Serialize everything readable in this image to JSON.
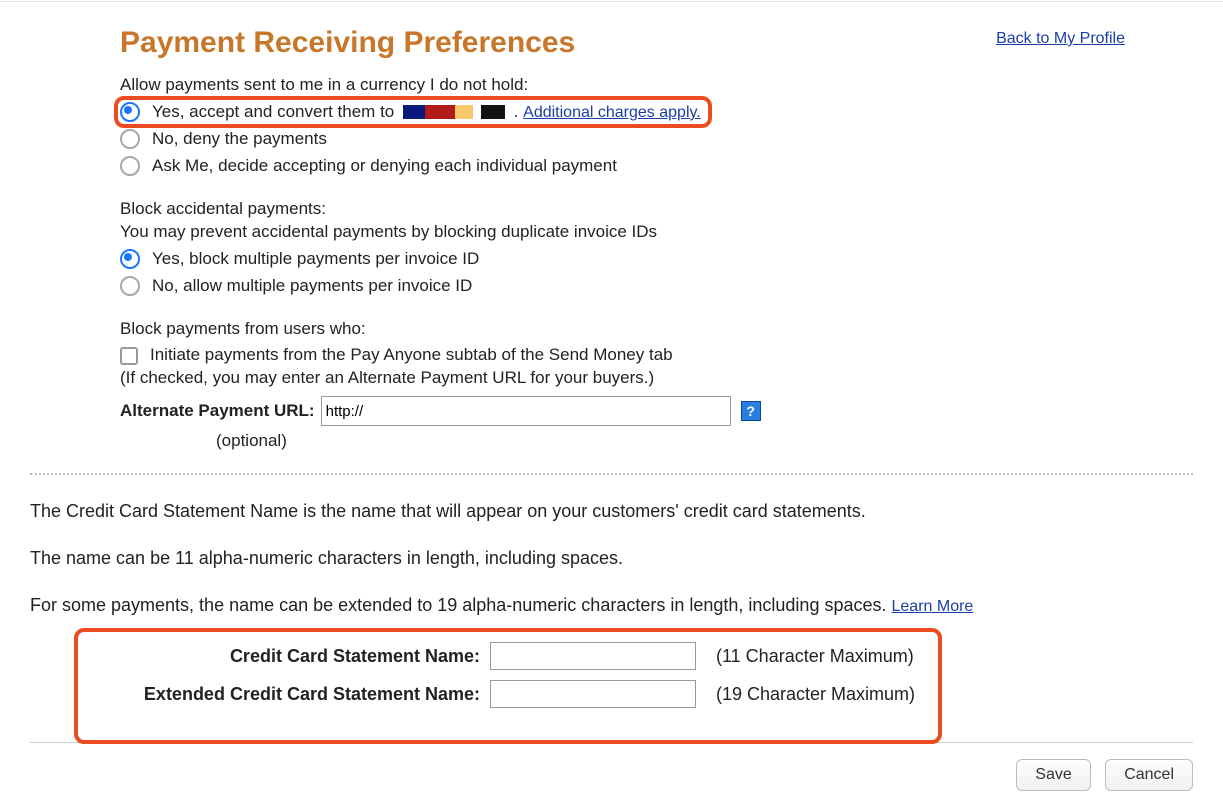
{
  "header": {
    "title": "Payment Receiving Preferences",
    "back_link": "Back to My Profile"
  },
  "currency_section": {
    "question": "Allow payments sent to me in a currency I do not hold:",
    "opt_yes_pre": "Yes, accept and convert them to ",
    "opt_yes_post": ". ",
    "opt_yes_link": "Additional charges apply.",
    "opt_no": "No, deny the payments",
    "opt_ask": "Ask Me, decide accepting or denying each individual payment",
    "selected": "yes"
  },
  "accidental_section": {
    "title": "Block accidental payments:",
    "subtitle": "You may prevent accidental payments by blocking duplicate invoice IDs",
    "opt_yes": "Yes, block multiple payments per invoice ID",
    "opt_no": "No, allow multiple payments per invoice ID",
    "selected": "yes"
  },
  "block_users": {
    "title": "Block payments from users who:",
    "checkbox_label": "Initiate payments from the Pay Anyone subtab of the Send Money tab",
    "hint": "(If checked, you may enter an Alternate Payment URL for your buyers.)",
    "alt_label": "Alternate Payment URL:",
    "alt_value": "http://",
    "optional": "(optional)"
  },
  "cc_section": {
    "p1": "The Credit Card Statement Name is the name that will appear on your customers' credit card statements.",
    "p2": "The name can be 11 alpha-numeric characters in length, including spaces.",
    "p3_pre": "For some payments, the name can be extended to 19 alpha-numeric characters in length, including spaces. ",
    "p3_link": "Learn More",
    "row1_label": "Credit Card Statement Name:",
    "row1_hint": "(11 Character Maximum)",
    "row2_label": "Extended Credit Card Statement Name:",
    "row2_hint": "(19 Character Maximum)"
  },
  "buttons": {
    "save": "Save",
    "cancel": "Cancel"
  }
}
